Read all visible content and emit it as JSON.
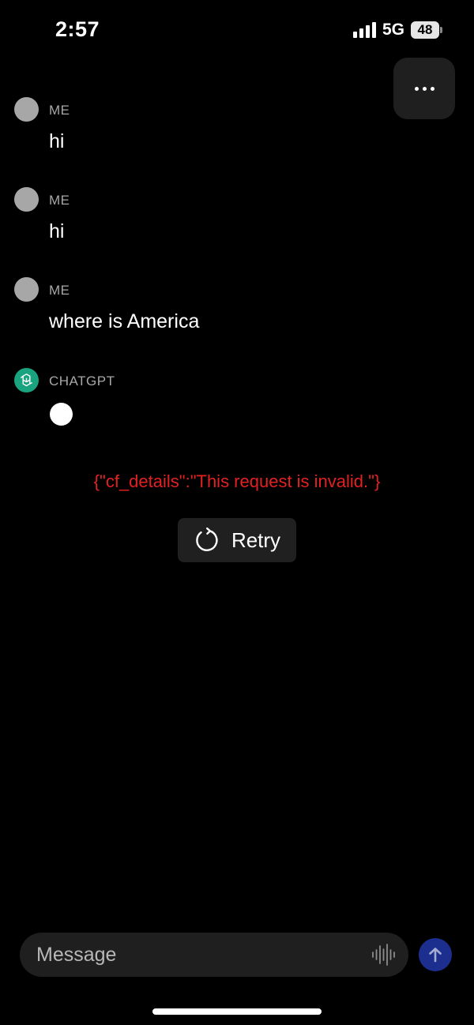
{
  "status_bar": {
    "time": "2:57",
    "network": "5G",
    "battery": "48"
  },
  "messages": [
    {
      "sender": "ME",
      "text": "hi"
    },
    {
      "sender": "ME",
      "text": "hi"
    },
    {
      "sender": "ME",
      "text": "where is America"
    },
    {
      "sender": "CHATGPT",
      "text": ""
    }
  ],
  "error": {
    "text": "{\"cf_details\":\"This request is invalid.\"}"
  },
  "retry": {
    "label": "Retry"
  },
  "composer": {
    "placeholder": "Message"
  },
  "colors": {
    "background": "#000000",
    "error": "#e32121",
    "gpt_avatar": "#19a37f",
    "send_button": "#1c2f8f"
  },
  "icons": {
    "more": "ellipsis-icon",
    "retry": "refresh-icon",
    "voice": "waveform-icon",
    "send": "arrow-up-icon",
    "gpt_avatar": "openai-logo-icon"
  }
}
